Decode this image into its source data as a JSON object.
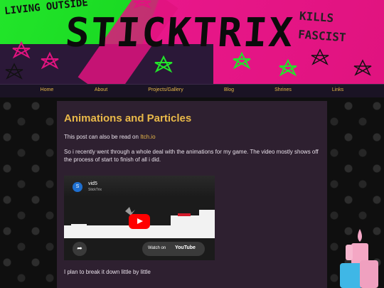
{
  "banner": {
    "title": "STICKTRIX",
    "top_left_text": "LIVING OUTSIDE",
    "top_right_line1": "KILLS",
    "top_right_line2": "FASCIST"
  },
  "nav": {
    "items": [
      {
        "label": "Home"
      },
      {
        "label": "About"
      },
      {
        "label": "Projects/Gallery"
      },
      {
        "label": "Blog"
      },
      {
        "label": "Shrines"
      },
      {
        "label": "Links"
      }
    ]
  },
  "post": {
    "title": "Animations and Particles",
    "intro_prefix": "This post can also be read on ",
    "intro_link": "Itch.io",
    "body": "So i recently went through a whole deal with the animations for my game. The video mostly shows off the process of start to finish of all i did.",
    "closing": "I plan to break it down little by little"
  },
  "video": {
    "avatar_letter": "S",
    "title": "vid5",
    "channel": "StickTrix",
    "watch_on": "Watch on",
    "platform": "YouTube",
    "share_icon": "share-icon"
  },
  "colors": {
    "accent": "#e9b949",
    "card_bg": "#2e2030",
    "banner_green": "#22e52a",
    "banner_pink": "#e0137f"
  }
}
